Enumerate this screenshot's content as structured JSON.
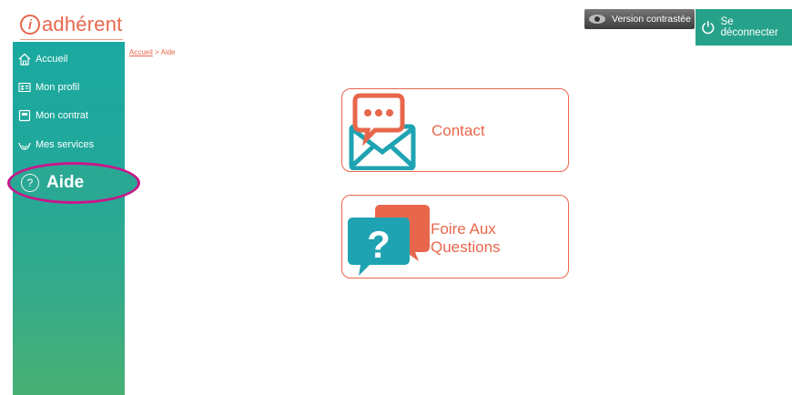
{
  "header": {
    "logo_text": "adhérent",
    "logo_letter": "i",
    "contrast_label": "Version contrastée",
    "logout_label": "Se déconnecter"
  },
  "sidebar": {
    "items": [
      {
        "label": "Accueil",
        "icon": "home-icon"
      },
      {
        "label": "Mon profil",
        "icon": "id-card-icon"
      },
      {
        "label": "Mon contrat",
        "icon": "document-icon"
      },
      {
        "label": "Mes services",
        "icon": "hands-icon"
      },
      {
        "label": "Aide",
        "icon": "help-icon",
        "active": true
      }
    ]
  },
  "breadcrumb": {
    "home": "Accueil",
    "separator": " > ",
    "current": "Aide"
  },
  "cards": {
    "contact": {
      "label": "Contact",
      "icon": "chat-envelope-icon"
    },
    "faq": {
      "label_line1": "Foire Aux",
      "label_line2": "Questions",
      "icon": "question-bubbles-icon"
    }
  },
  "colors": {
    "accent_orange": "#e8674c",
    "sidebar_teal": "#1aa9a1",
    "sidebar_green": "#49b074",
    "active_outline": "#c7178a",
    "logout_bg": "#27a28a",
    "icon_teal": "#1fa3b2"
  }
}
